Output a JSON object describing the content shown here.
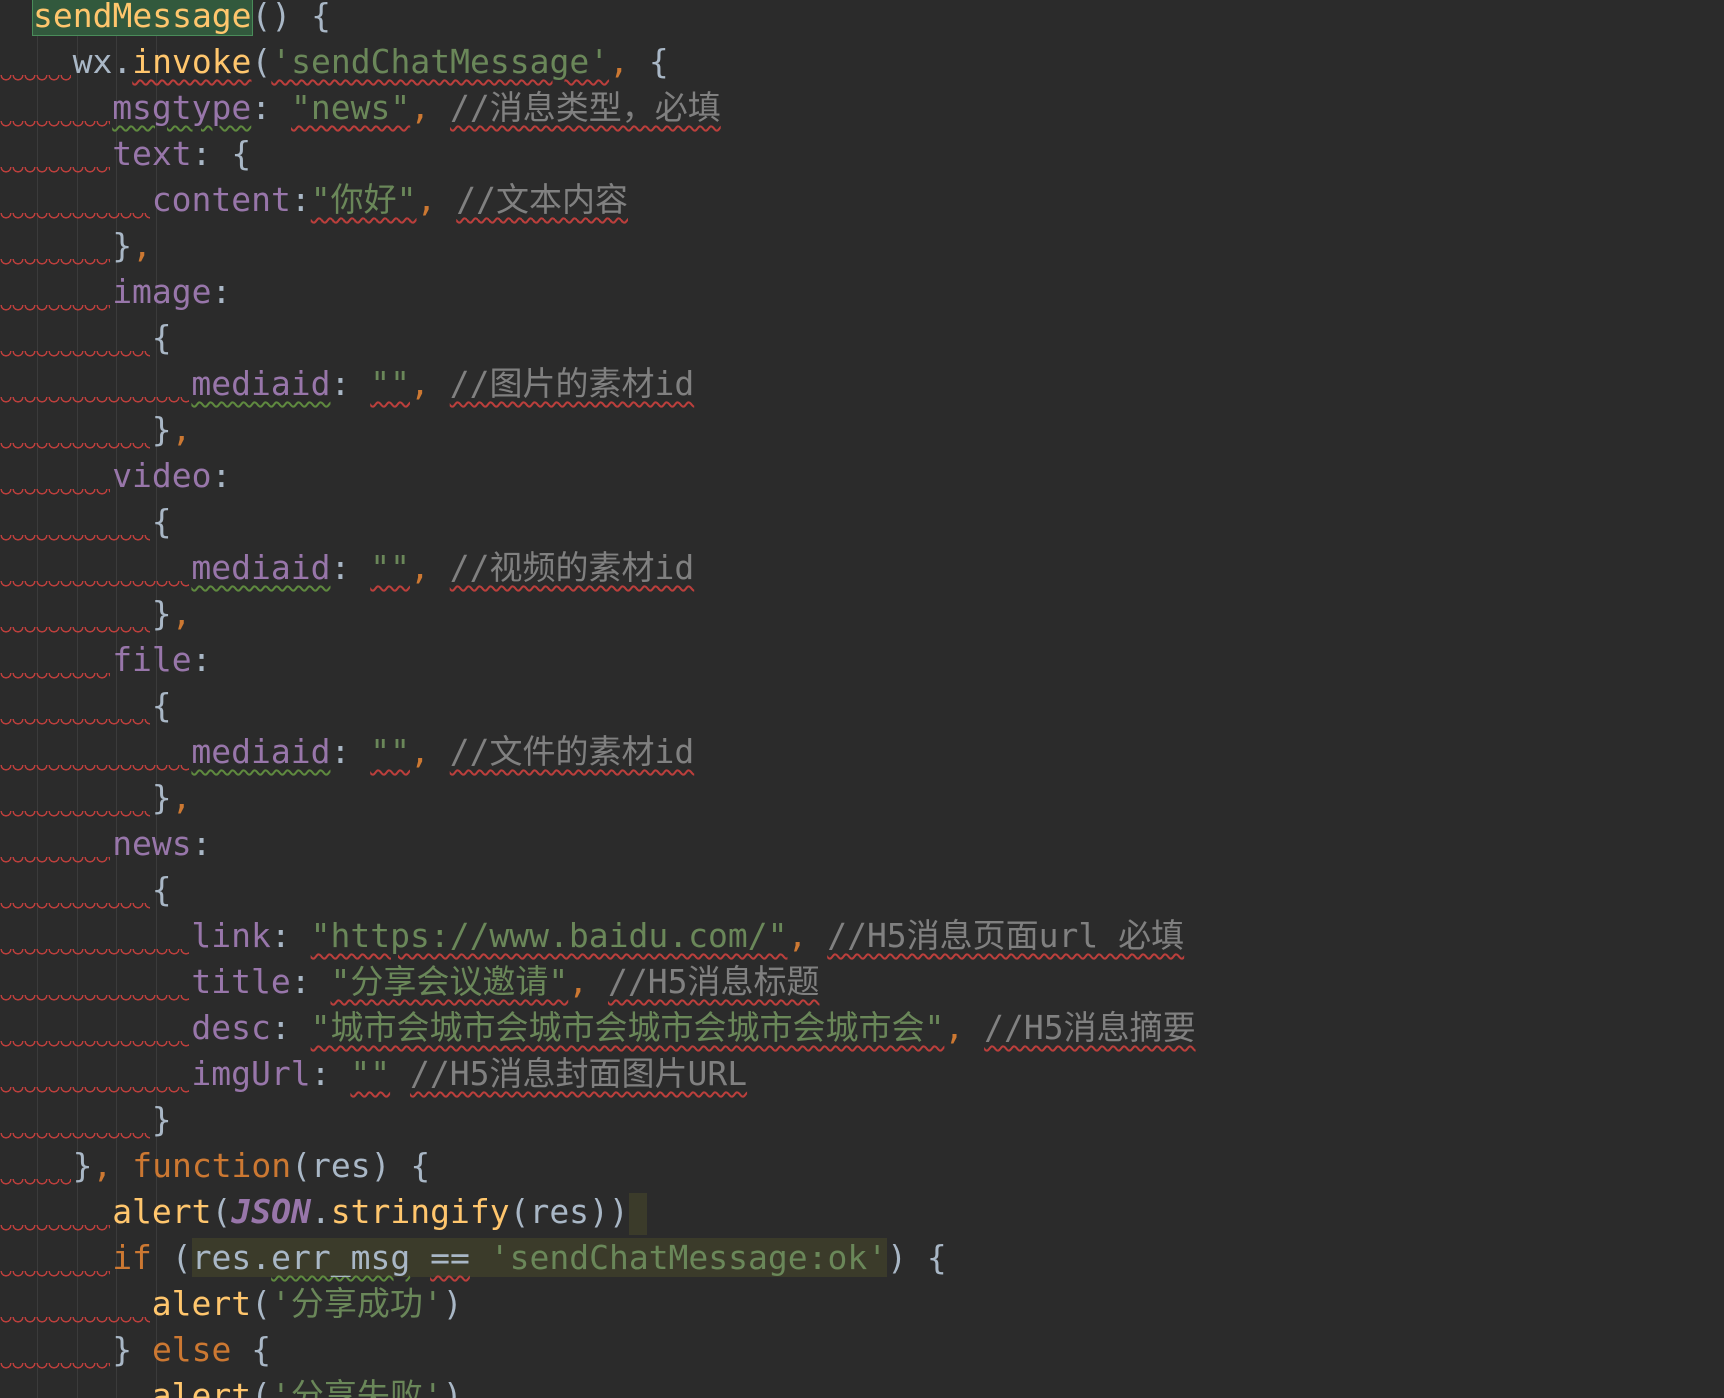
{
  "editor": {
    "lines": [
      {
        "indent": 0,
        "tokens": [
          {
            "t": "sendMessage",
            "c": "fn hl-green"
          },
          {
            "t": "() {",
            "c": "p"
          }
        ]
      },
      {
        "indent": 1,
        "tokens": [
          {
            "t": "wx",
            "c": "p"
          },
          {
            "t": ".",
            "c": "p"
          },
          {
            "t": "invoke",
            "c": "fn sq"
          },
          {
            "t": "(",
            "c": "p"
          },
          {
            "t": "'sendChatMessage'",
            "c": "st sq"
          },
          {
            "t": ", ",
            "c": "kw"
          },
          {
            "t": "{",
            "c": "p"
          }
        ]
      },
      {
        "indent": 2,
        "tokens": [
          {
            "t": "msgtype",
            "c": "pr sqg"
          },
          {
            "t": ": ",
            "c": "p"
          },
          {
            "t": "\"news\"",
            "c": "st sq"
          },
          {
            "t": ", ",
            "c": "kw"
          },
          {
            "t": "//消息类型，必填",
            "c": "cm sq"
          }
        ]
      },
      {
        "indent": 2,
        "tokens": [
          {
            "t": "text",
            "c": "pr"
          },
          {
            "t": ": {",
            "c": "p"
          }
        ]
      },
      {
        "indent": 3,
        "tokens": [
          {
            "t": "content",
            "c": "pr"
          },
          {
            "t": ":",
            "c": "p"
          },
          {
            "t": "\"你好\"",
            "c": "st sq"
          },
          {
            "t": ", ",
            "c": "kw"
          },
          {
            "t": "//文本内容",
            "c": "cm sq"
          }
        ]
      },
      {
        "indent": 2,
        "tokens": [
          {
            "t": "}",
            "c": "p"
          },
          {
            "t": ",",
            "c": "kw"
          }
        ]
      },
      {
        "indent": 2,
        "tokens": [
          {
            "t": "image",
            "c": "pr"
          },
          {
            "t": ":",
            "c": "p"
          }
        ]
      },
      {
        "indent": 3,
        "tokens": [
          {
            "t": "{",
            "c": "p"
          }
        ]
      },
      {
        "indent": 4,
        "tokens": [
          {
            "t": "mediaid",
            "c": "pr sqg"
          },
          {
            "t": ": ",
            "c": "p"
          },
          {
            "t": "\"\"",
            "c": "st sq"
          },
          {
            "t": ", ",
            "c": "kw"
          },
          {
            "t": "//图片的素材id",
            "c": "cm sq"
          }
        ]
      },
      {
        "indent": 3,
        "tokens": [
          {
            "t": "}",
            "c": "p"
          },
          {
            "t": ",",
            "c": "kw"
          }
        ]
      },
      {
        "indent": 2,
        "tokens": [
          {
            "t": "video",
            "c": "pr"
          },
          {
            "t": ":",
            "c": "p"
          }
        ]
      },
      {
        "indent": 3,
        "tokens": [
          {
            "t": "{",
            "c": "p"
          }
        ]
      },
      {
        "indent": 4,
        "tokens": [
          {
            "t": "mediaid",
            "c": "pr sqg"
          },
          {
            "t": ": ",
            "c": "p"
          },
          {
            "t": "\"\"",
            "c": "st sq"
          },
          {
            "t": ", ",
            "c": "kw"
          },
          {
            "t": "//视频的素材id",
            "c": "cm sq"
          }
        ]
      },
      {
        "indent": 3,
        "tokens": [
          {
            "t": "}",
            "c": "p"
          },
          {
            "t": ",",
            "c": "kw"
          }
        ]
      },
      {
        "indent": 2,
        "tokens": [
          {
            "t": "file",
            "c": "pr"
          },
          {
            "t": ":",
            "c": "p"
          }
        ]
      },
      {
        "indent": 3,
        "tokens": [
          {
            "t": "{",
            "c": "p"
          }
        ]
      },
      {
        "indent": 4,
        "tokens": [
          {
            "t": "mediaid",
            "c": "pr sqg"
          },
          {
            "t": ": ",
            "c": "p"
          },
          {
            "t": "\"\"",
            "c": "st sq"
          },
          {
            "t": ", ",
            "c": "kw"
          },
          {
            "t": "//文件的素材id",
            "c": "cm sq"
          }
        ]
      },
      {
        "indent": 3,
        "tokens": [
          {
            "t": "}",
            "c": "p"
          },
          {
            "t": ",",
            "c": "kw"
          }
        ]
      },
      {
        "indent": 2,
        "tokens": [
          {
            "t": "news",
            "c": "pr"
          },
          {
            "t": ":",
            "c": "p"
          }
        ]
      },
      {
        "indent": 3,
        "tokens": [
          {
            "t": "{",
            "c": "p"
          }
        ]
      },
      {
        "indent": 4,
        "tokens": [
          {
            "t": "link",
            "c": "pr"
          },
          {
            "t": ": ",
            "c": "p"
          },
          {
            "t": "\"https://www.baidu.com/\"",
            "c": "st sq"
          },
          {
            "t": ", ",
            "c": "kw"
          },
          {
            "t": "//H5消息页面url 必填",
            "c": "cm sq"
          }
        ]
      },
      {
        "indent": 4,
        "tokens": [
          {
            "t": "title",
            "c": "pr"
          },
          {
            "t": ": ",
            "c": "p"
          },
          {
            "t": "\"分享会议邀请\"",
            "c": "st sq"
          },
          {
            "t": ", ",
            "c": "kw"
          },
          {
            "t": "//H5消息标题",
            "c": "cm sq"
          }
        ]
      },
      {
        "indent": 4,
        "tokens": [
          {
            "t": "desc",
            "c": "pr"
          },
          {
            "t": ": ",
            "c": "p"
          },
          {
            "t": "\"城市会城市会城市会城市会城市会城市会\"",
            "c": "st sq"
          },
          {
            "t": ", ",
            "c": "kw"
          },
          {
            "t": "//H5消息摘要",
            "c": "cm sq"
          }
        ]
      },
      {
        "indent": 4,
        "tokens": [
          {
            "t": "imgUrl",
            "c": "pr"
          },
          {
            "t": ": ",
            "c": "p"
          },
          {
            "t": "\"\"",
            "c": "st sq"
          },
          {
            "t": " ",
            "c": "p"
          },
          {
            "t": "//H5消息封面图片URL",
            "c": "cm sq"
          }
        ]
      },
      {
        "indent": 3,
        "tokens": [
          {
            "t": "}",
            "c": "p"
          }
        ]
      },
      {
        "indent": 1,
        "tokens": [
          {
            "t": "}",
            "c": "p"
          },
          {
            "t": ", ",
            "c": "kw"
          },
          {
            "t": "function",
            "c": "kw"
          },
          {
            "t": "(res) {",
            "c": "p"
          }
        ]
      },
      {
        "indent": 2,
        "tokens": [
          {
            "t": "alert",
            "c": "fn"
          },
          {
            "t": "(",
            "c": "p"
          },
          {
            "t": "JSON",
            "c": "cj"
          },
          {
            "t": ".",
            "c": "p"
          },
          {
            "t": "stringify",
            "c": "fn"
          },
          {
            "t": "(res))",
            "c": "p"
          },
          {
            "t": "",
            "c": "caret-block"
          }
        ]
      },
      {
        "indent": 2,
        "tokens": [
          {
            "t": "if",
            "c": "kw"
          },
          {
            "t": " (",
            "c": "p"
          },
          {
            "t": "res.",
            "c": "p hl-olive"
          },
          {
            "t": "err_msg",
            "c": "p hl-olive sqg"
          },
          {
            "t": " ",
            "c": "p hl-olive"
          },
          {
            "t": "==",
            "c": "p hl-olive sq"
          },
          {
            "t": " ",
            "c": "p hl-olive"
          },
          {
            "t": "'sendChatMessage:ok'",
            "c": "st hl-olive"
          },
          {
            "t": ") {",
            "c": "p"
          }
        ]
      },
      {
        "indent": 3,
        "tokens": [
          {
            "t": "alert",
            "c": "fn"
          },
          {
            "t": "(",
            "c": "p"
          },
          {
            "t": "'分享成功'",
            "c": "st"
          },
          {
            "t": ")",
            "c": "p"
          }
        ]
      },
      {
        "indent": 2,
        "tokens": [
          {
            "t": "} ",
            "c": "p"
          },
          {
            "t": "else",
            "c": "kw"
          },
          {
            "t": " {",
            "c": "p"
          }
        ]
      },
      {
        "indent": 3,
        "tokens": [
          {
            "t": "alert",
            "c": "fn"
          },
          {
            "t": "(",
            "c": "p"
          },
          {
            "t": "'分享失败'",
            "c": "st"
          },
          {
            "t": ")",
            "c": "p"
          }
        ]
      }
    ]
  }
}
